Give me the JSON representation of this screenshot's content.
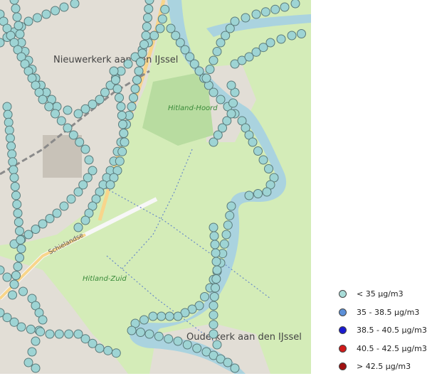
{
  "map": {
    "place_labels": {
      "nieuwerkerk": "Nieuwerkerk aan den IJssel",
      "hitland_hoord": "Hitland-Hoord",
      "hitland_zuid": "Hitland-Zuid",
      "ouderkerk": "Ouderkerk aan den IJssel",
      "road": "Schielandse"
    },
    "colors": {
      "land": "#d4ecb8",
      "town": "#e0dcd4",
      "river": "#aad3df",
      "road": "#f7f7f7",
      "major_road": "#f8d58b",
      "railway": "#8a8a8a",
      "marker": "#9ed4d4"
    }
  },
  "legend": {
    "items": [
      {
        "label": "< 35 µg/m3",
        "color": "#a8dcd8"
      },
      {
        "label": "35 - 38.5 µg/m3",
        "color": "#5c90d8"
      },
      {
        "label": "38.5 - 40.5 µg/m3",
        "color": "#1a1ad0"
      },
      {
        "label": "40.5 - 42.5 µg/m3",
        "color": "#d01a1a"
      },
      {
        "label": "> 42.5 µg/m3",
        "color": "#a01010"
      }
    ]
  }
}
